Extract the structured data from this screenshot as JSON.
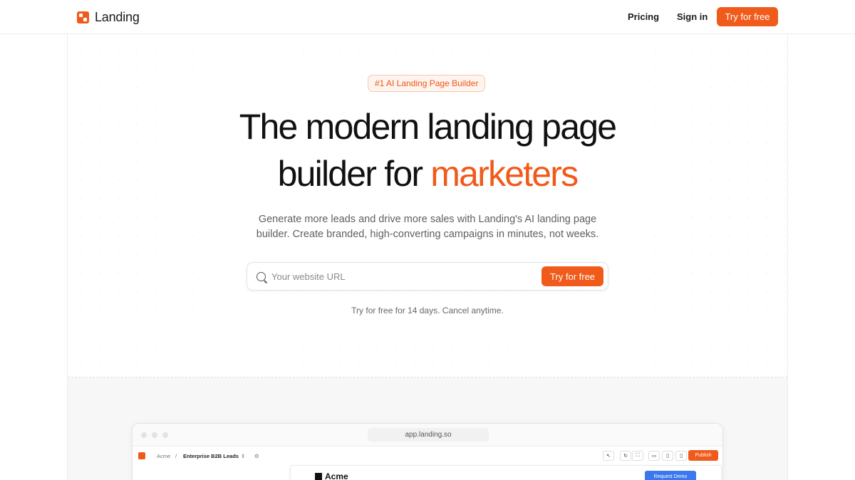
{
  "nav": {
    "brand": "Landing",
    "links": [
      "Pricing",
      "Sign in"
    ],
    "cta": "Try for free"
  },
  "hero": {
    "badge": "#1 AI Landing Page Builder",
    "headline_line1": "The modern landing page",
    "headline_line2_prefix": "builder for ",
    "headline_line2_accent": "marketers",
    "subheadline_line1": "Generate more leads and drive more sales with Landing's AI landing page",
    "subheadline_line2": "builder. Create branded, high-converting campaigns in minutes, not weeks.",
    "search_placeholder": "Your website URL",
    "search_cta": "Try for free",
    "trial_note": "Try for free for 14 days. Cancel anytime."
  },
  "app_preview": {
    "url": "app.landing.so",
    "breadcrumb": [
      "Acme",
      "/",
      "Enterprise B2B Leads"
    ],
    "publish": "Publish",
    "canvas_brand": "Acme",
    "canvas_cta": "Request Demo"
  },
  "colors": {
    "accent": "#f05a1a",
    "badge_bg": "#fff4ee",
    "demo_button": "#3b78f0"
  }
}
